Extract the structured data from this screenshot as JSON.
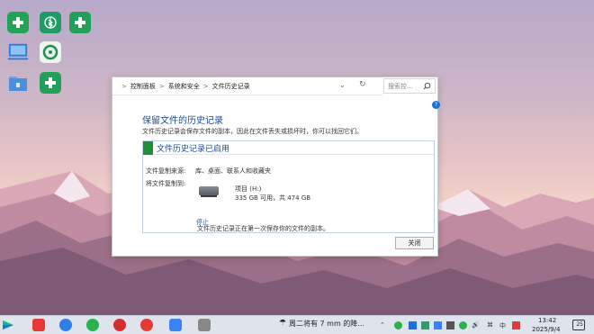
{
  "window": {
    "breadcrumb": [
      "控制面板",
      "系统和安全",
      "文件历史记录"
    ],
    "breadcrumb_sep": ">",
    "search_placeholder": "搜索控...",
    "help_label": "?",
    "heading": "保留文件的历史记录",
    "description": "文件历史记录会保存文件的副本，因此在文件丢失或损坏时，你可以找回它们。",
    "panel": {
      "title": "文件历史记录已启用",
      "copy_from_label": "文件复制来源:",
      "copy_from_value": "库、桌面、联系人和收藏夹",
      "copy_to_label": "将文件复制到:",
      "drive_name": "项目 (H:)",
      "drive_space": "335 GB 可用，共 474 GB",
      "status": "文件历史记录正在第一次保存你的文件的副本。",
      "stop_link": "停止"
    },
    "close_button": "关闭"
  },
  "taskbar": {
    "weather_text": "周二将有 7 mm 的降...",
    "tray_lang": "中",
    "clock_time": "13:42",
    "clock_date": "2025/9/4",
    "notification_count": "25"
  },
  "colors": {
    "accent": "#1e4a94",
    "panel_bar": "#1f8f3a",
    "link": "#1a5fb4"
  },
  "icons": {
    "desktop": [
      "green-plus-app-icon",
      "green-bluetooth-app-icon",
      "green-plus-app-icon-2",
      "this-pc-icon",
      "green-sync-app-icon",
      "recycle-bin-icon",
      "green-plus-app-icon-3"
    ],
    "taskbar": [
      "start-icon",
      "wps-icon",
      "browser-icon",
      "wechat-icon",
      "netease-music-icon",
      "netease-app-icon",
      "feishu-icon",
      "device-icon"
    ]
  }
}
